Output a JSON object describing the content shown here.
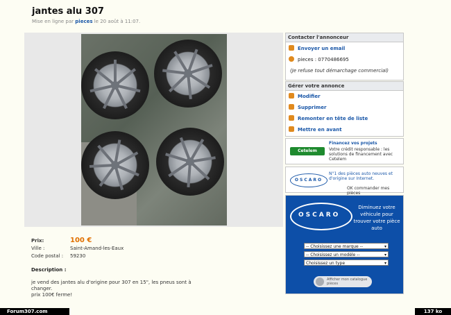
{
  "ad": {
    "title": "jantes alu 307",
    "meta_prefix": "Mise en ligne par ",
    "seller": "pieces",
    "meta_suffix": " le 20 août à 11:07."
  },
  "details": {
    "price_label": "Prix:",
    "price": "100 €",
    "city_label": "Ville :",
    "city": "Saint-Amand-les-Eaux",
    "postal_label": "Code postal :",
    "postal": "59230",
    "desc_label": "Description :",
    "desc": "je vend des jantes alu d'origine pour 307 en 15\", les pneus sont à\nchanger.\nprix 100€ ferme!"
  },
  "contact": {
    "header": "Contacter l'annonceur",
    "email": "Envoyer un email",
    "phone": "pieces : 0770486695",
    "no_solicit": "(Je refuse tout démarchage commercial)"
  },
  "manage": {
    "header": "Gérer votre annonce",
    "modify": "Modifier",
    "delete": "Supprimer",
    "bump": "Remonter en tête de liste",
    "feature": "Mettre en avant"
  },
  "promo_cetelem": {
    "logo": "Cetelem",
    "title": "Financez vos projets",
    "text": "Votre crédit responsable : les solutions de financement avec Cetelem"
  },
  "promo_oscaro": {
    "logo": "OSCARO",
    "title": "N°1 des pièces auto neuves et d'origine sur Internet.",
    "link": "OK commander mes pièces"
  },
  "oscaro_ad": {
    "logo": "OSCARO",
    "headline": "Diminuez votre véhicule pour trouver votre pièce auto",
    "select1": "-- Choisissez une marque --",
    "select2": "-- Choisissez un modèle --",
    "select3": "Choisissez un type",
    "catalog": "Afficher mon catalogue pièces"
  },
  "watermark": {
    "left": "Forum307.com",
    "right": "137 ko"
  },
  "colors": {
    "price": "#e07000",
    "link": "#1a57a8",
    "ad_bg": "#0d4fa8"
  }
}
